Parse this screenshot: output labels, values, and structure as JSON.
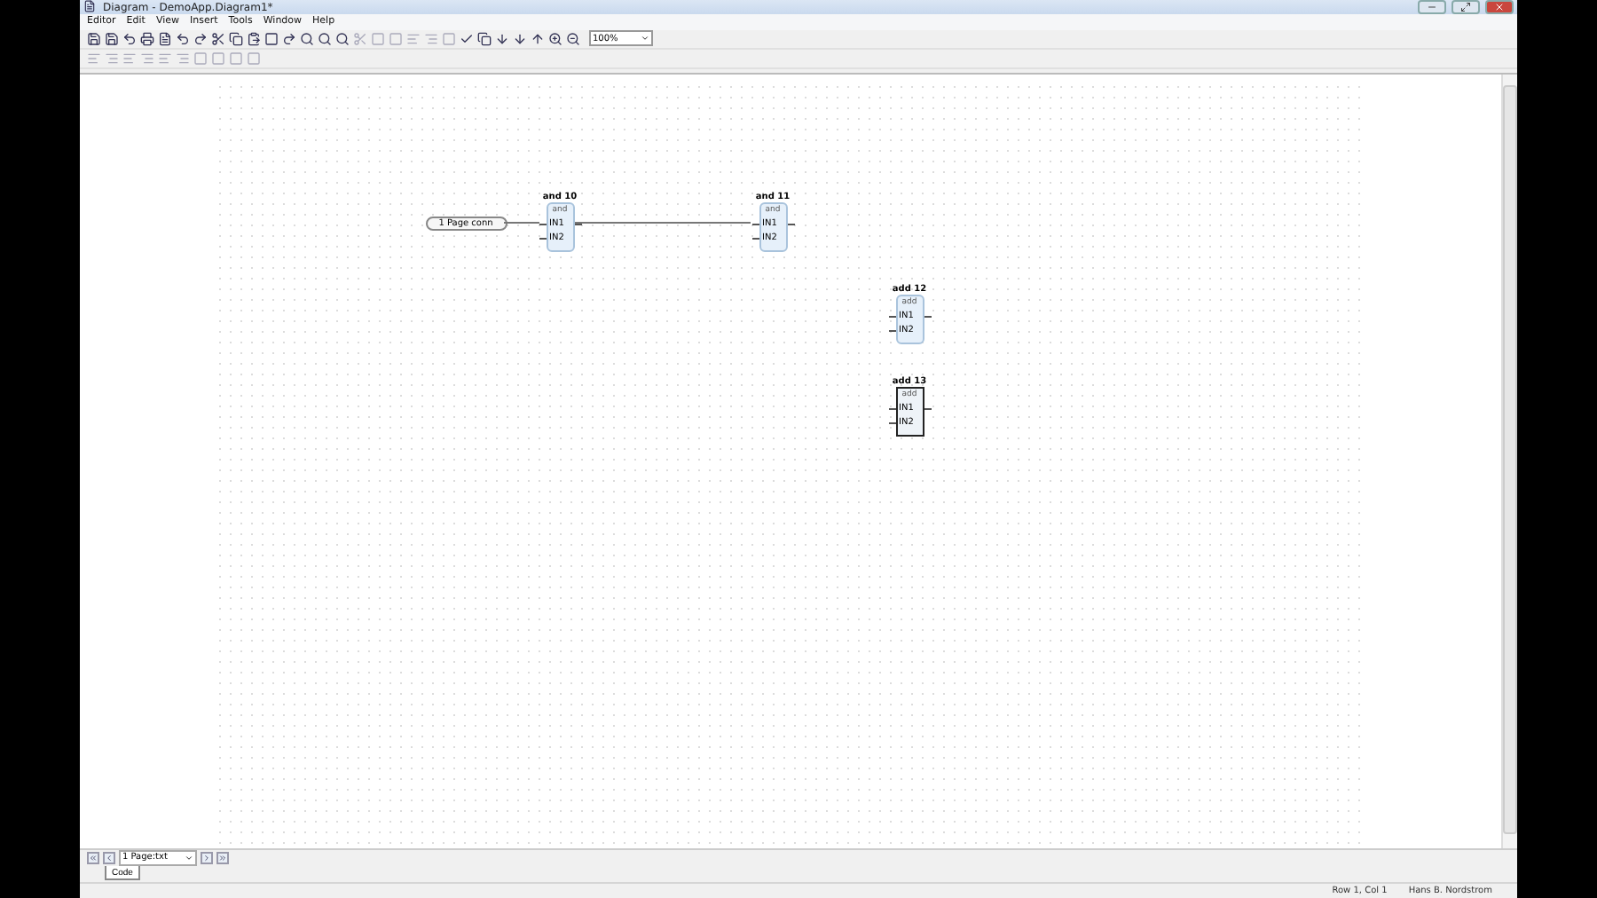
{
  "window": {
    "title": "Diagram - DemoApp.Diagram1*"
  },
  "menu": [
    "Editor",
    "Edit",
    "View",
    "Insert",
    "Tools",
    "Window",
    "Help"
  ],
  "zoom": {
    "value": "100%"
  },
  "connector": {
    "label": "1 Page conn"
  },
  "blocks": [
    {
      "title": "and 10",
      "type": "and",
      "inputs": [
        "IN1",
        "IN2"
      ],
      "selected": false
    },
    {
      "title": "and 11",
      "type": "and",
      "inputs": [
        "IN1",
        "IN2"
      ],
      "selected": false
    },
    {
      "title": "add 12",
      "type": "add",
      "inputs": [
        "IN1",
        "IN2"
      ],
      "selected": false
    },
    {
      "title": "add 13",
      "type": "add",
      "inputs": [
        "IN1",
        "IN2"
      ],
      "selected": true
    }
  ],
  "pages": {
    "value": "1 Page:txt"
  },
  "tabs": [
    {
      "label": "Code",
      "selected": true
    }
  ],
  "status_bar": {
    "position": "Row 1, Col 1",
    "user": "Hans B. Nordstrom"
  }
}
